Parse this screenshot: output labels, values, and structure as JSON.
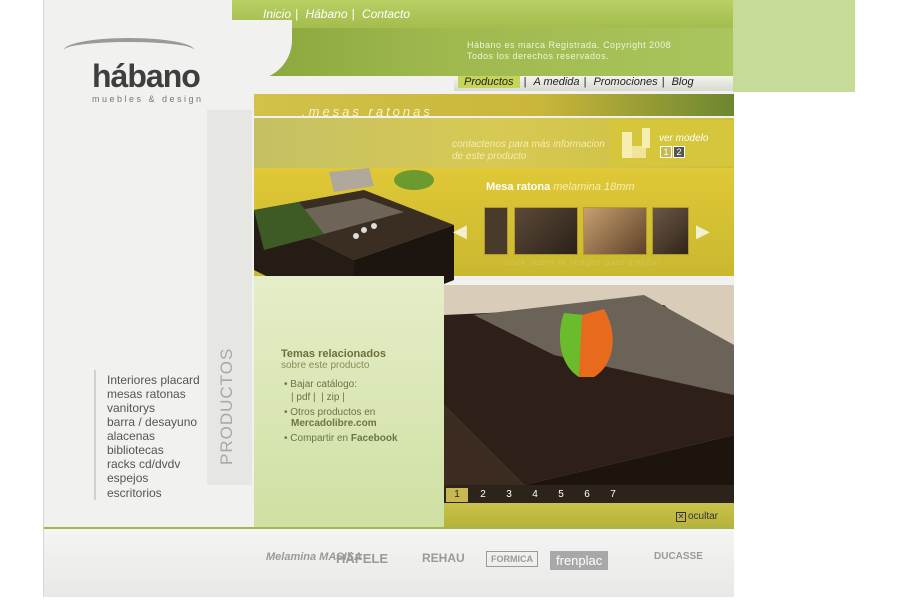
{
  "topnav": [
    "Inicio",
    "Hábano",
    "Contacto"
  ],
  "copyright": [
    "Hábano es marca Registrada. Copyright 2008",
    "Todos los derechos reservados."
  ],
  "prodnav": [
    "Productos",
    "A medida",
    "Promociones",
    "Blog"
  ],
  "logo": {
    "name": "hábano",
    "tagline": "muebles & design"
  },
  "section_title": ".mesas ratonas",
  "contact_text": [
    "contactenos para más informacion",
    "de este producto"
  ],
  "ver_modelo": {
    "label": "ver modelo",
    "options": [
      "1",
      "2"
    ]
  },
  "product": {
    "name": "Mesa ratona",
    "detail": "melamina 18mm",
    "hint": "click sobre la imagen para ampliar"
  },
  "sidebar": {
    "section_label": "PRODUCTOS",
    "items": [
      "Interiores placard",
      "mesas ratonas",
      "vanitorys",
      "barra / desayuno",
      "alacenas",
      "bibliotecas",
      "racks cd/dvdv",
      "espejos",
      "escritorios"
    ]
  },
  "related": {
    "title": "Temas relacionados",
    "subtitle": "sobre este producto",
    "catalog_label": "Bajar catálogo:",
    "pdf": "| pdf |",
    "zip": "| zip |",
    "otros": "Otros productos en",
    "mercadolibre": "Mercadolibre.com",
    "compartir": "Compartir en",
    "facebook": "Facebook"
  },
  "pager": [
    "1",
    "2",
    "3",
    "4",
    "5",
    "6",
    "7"
  ],
  "ocultar": "ocultar",
  "brands": [
    "Melamina MASISA",
    "HÄFELE",
    "REHAU",
    "FORMICA",
    "frenplac",
    "DUCASSE"
  ],
  "colors": {
    "accent_green": "#9fb94f",
    "accent_yellow": "#d6c63c",
    "logo_gray": "#3e3e3e"
  }
}
